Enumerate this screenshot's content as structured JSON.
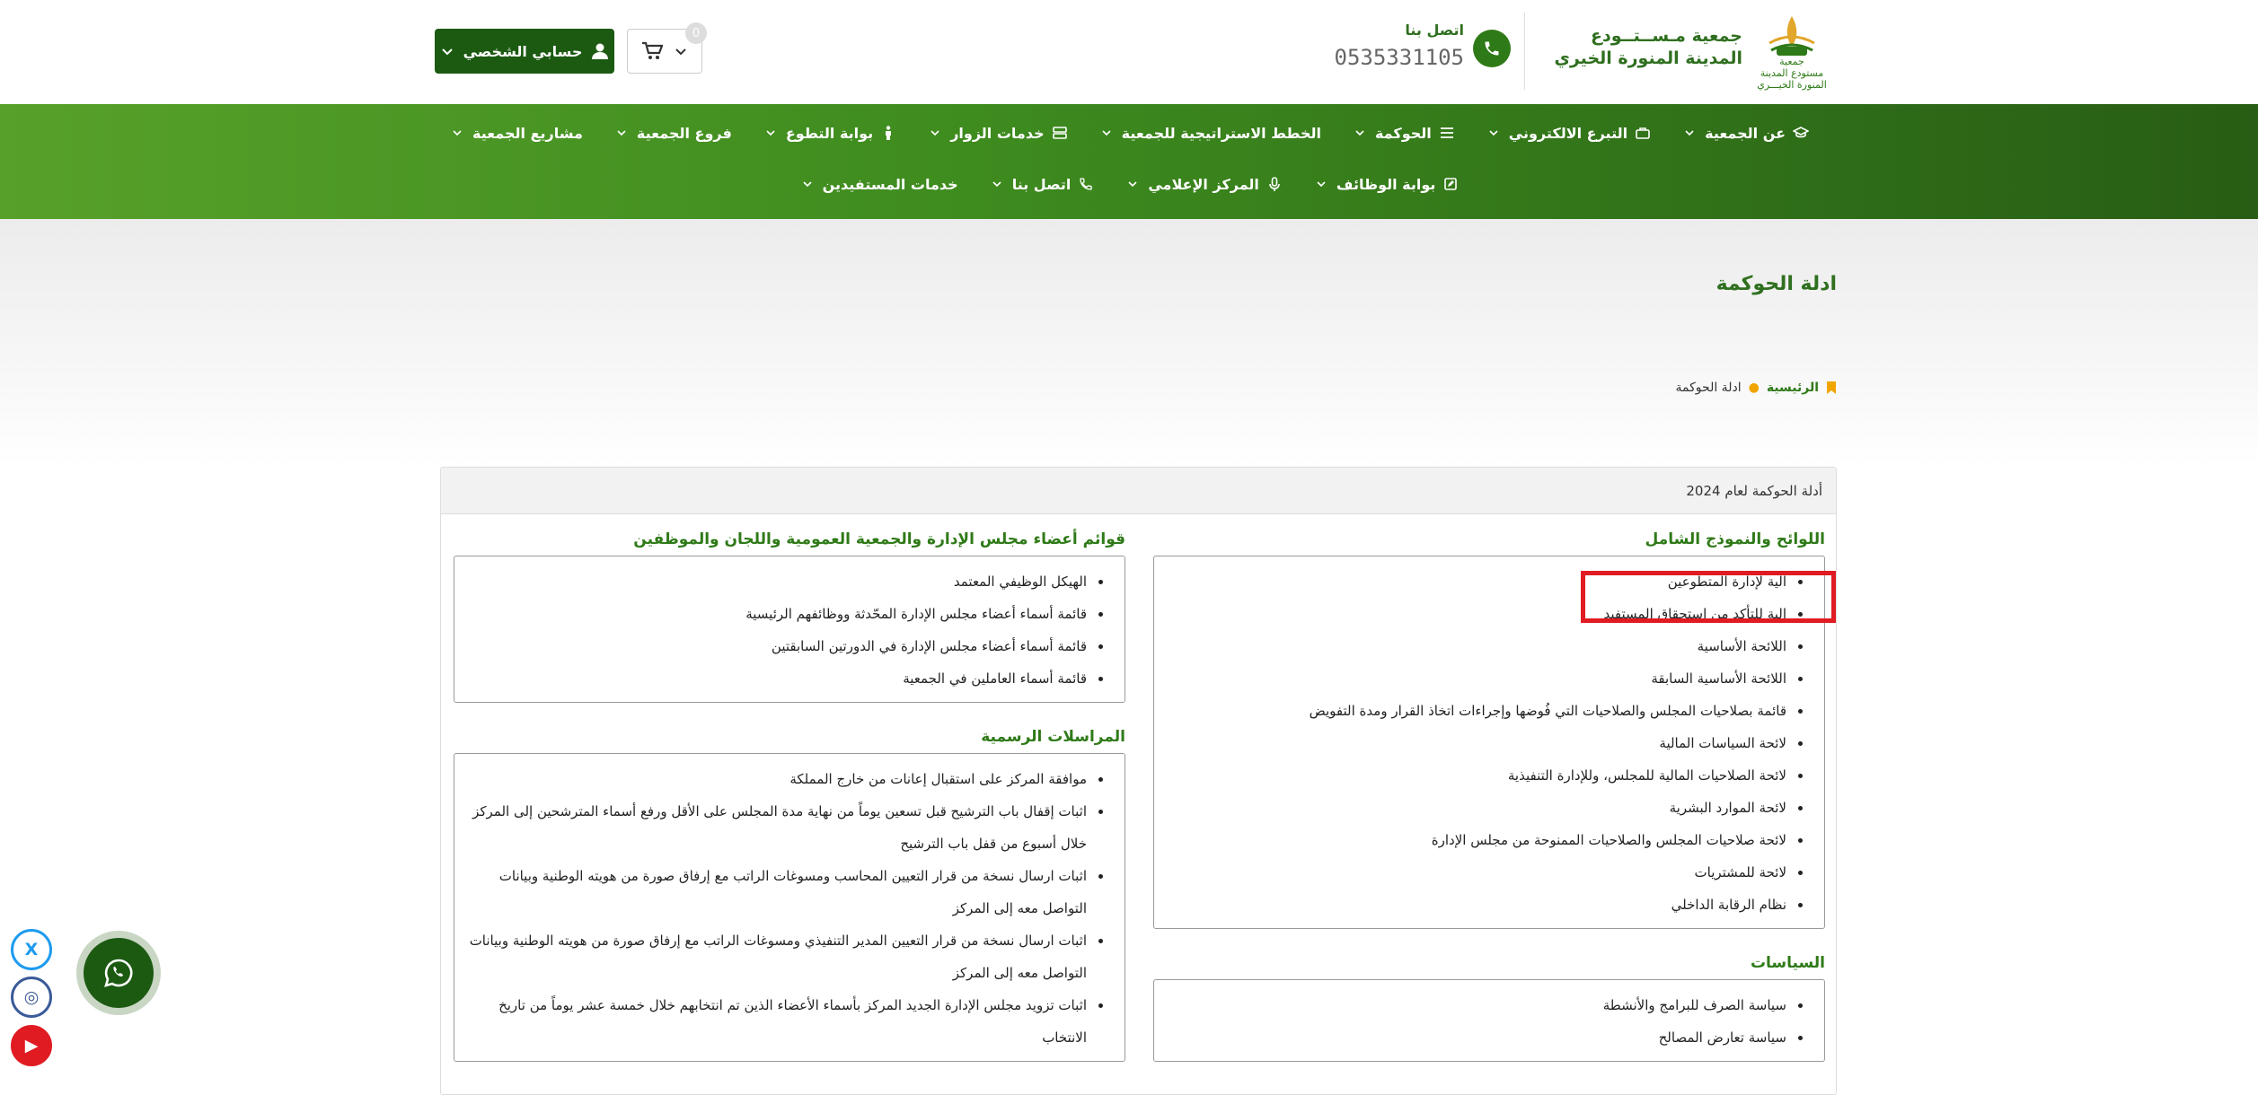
{
  "header": {
    "org_name_line1": "جمعية مـســتــودع",
    "org_name_line2": "المدينة المنورة الخيري",
    "logo_text_line1": "جمعية",
    "logo_text_line2": "مستودع المدينة",
    "logo_text_line3": "المنورة الخيـــري",
    "contact_label": "اتصل بنا",
    "contact_phone": "0535331105",
    "cart_count": "0",
    "account_label": "حسابي الشخصي",
    "brand_color": "#2f7a18",
    "dark_green": "#1c5a12"
  },
  "nav": {
    "row1": [
      {
        "label": "عن الجمعية",
        "icon": "graduation-cap-icon",
        "dropdown": true
      },
      {
        "label": "التبرع الالكتروني",
        "icon": "briefcase-icon",
        "dropdown": true
      },
      {
        "label": "الحوكمة",
        "icon": "list-icon",
        "dropdown": true
      },
      {
        "label": "الخطط الاستراتيجية للجمعية",
        "icon": "",
        "dropdown": true
      },
      {
        "label": "خدمات الزوار",
        "icon": "server-icon",
        "dropdown": true
      },
      {
        "label": "بوابة التطوع",
        "icon": "person-icon",
        "dropdown": true
      },
      {
        "label": "فروع الجمعية",
        "icon": "",
        "dropdown": true
      },
      {
        "label": "مشاريع الجمعية",
        "icon": "",
        "dropdown": true
      }
    ],
    "row2": [
      {
        "label": "بوابة الوظائف",
        "icon": "edit-icon",
        "dropdown": true
      },
      {
        "label": "المركز الإعلامي",
        "icon": "microphone-icon",
        "dropdown": true
      },
      {
        "label": "اتصل بنا",
        "icon": "phone-icon",
        "dropdown": true
      },
      {
        "label": "خدمات المستفيدين",
        "icon": "",
        "dropdown": true
      }
    ]
  },
  "page": {
    "title": "ادلة الحوكمة",
    "breadcrumb_home": "الرئيسية",
    "breadcrumb_current": "ادلة الحوكمة"
  },
  "card": {
    "header": "أدلة الحوكمة لعام 2024",
    "sections_right": [
      {
        "title": "اللوائح والنموذج الشامل",
        "items": [
          "الية لإدارة المتطوعين",
          "الية للتأكد من استحقاق المستفيد",
          "اللائحة الأساسية",
          "اللائحة الأساسية السابقة",
          "قائمة بصلاحيات المجلس والصلاحيات التي فُوضها وإجراءات اتخاذ القرار ومدة التفويض",
          "لائحة السياسات المالية",
          "لائحة الصلاحيات المالية للمجلس، وللإدارة التنفيذية",
          "لائحة الموارد البشرية",
          "لائحة صلاحيات المجلس والصلاحيات الممنوحة من مجلس الإدارة",
          "لائحة للمشتريات",
          "نظام الرقابة الداخلي"
        ]
      },
      {
        "title": "السياسات",
        "items": [
          "سياسة الصرف للبرامج والأنشطة",
          "سياسة تعارض المصالح"
        ]
      }
    ],
    "sections_left": [
      {
        "title": "قوائم أعضاء مجلس الإدارة والجمعية العمومية واللجان والموظفين",
        "items": [
          "الهيكل الوظيفي المعتمد",
          "قائمة أسماء أعضاء مجلس الإدارة المحّدثة ووظائفهم الرئيسية",
          "قائمة أسماء أعضاء مجلس الإدارة في الدورتين السابقتين",
          "قائمة أسماء العاملين في الجمعية"
        ]
      },
      {
        "title": "المراسلات الرسمية",
        "items": [
          "موافقة المركز على استقبال إعانات من خارج المملكة",
          "اثبات إقفال باب الترشيح قبل تسعين يوماً من نهاية مدة المجلس على الأقل ورفع أسماء المترشحين إلى المركز خلال أسبوع من قفل باب الترشيح",
          "اثبات ارسال نسخة من قرار التعيين المحاسب ومسوغات الراتب مع إرفاق صورة من هويته الوطنية وبيانات التواصل معه إلى المركز",
          "اثبات ارسال نسخة من قرار التعيين المدير التنفيذي ومسوغات الراتب مع إرفاق صورة من هويته الوطنية وبيانات التواصل معه إلى المركز",
          "اثبات تزويد مجلس الإدارة الجديد المركز بأسماء الأعضاء الذين تم انتخابهم خلال خمسة عشر يوماً من تاريخ الانتخاب"
        ]
      }
    ]
  },
  "floats": {
    "x_label": "X",
    "ig_label": "◎",
    "yt_label": "▶"
  }
}
